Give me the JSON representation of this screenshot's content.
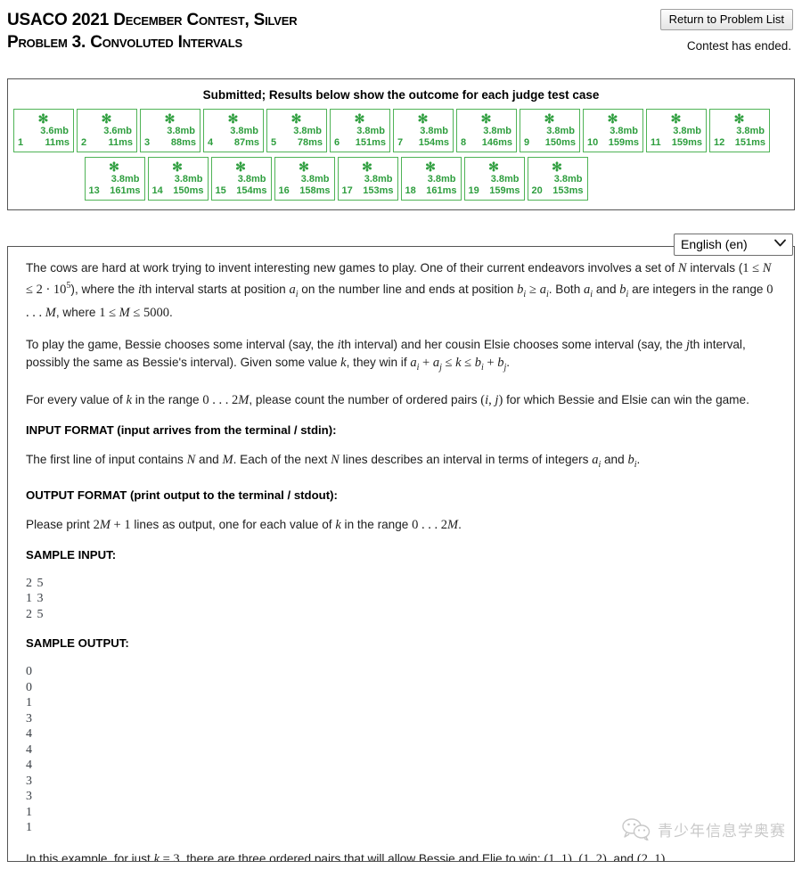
{
  "header": {
    "contest_title": "USACO 2021 December Contest, Silver",
    "problem_title": "Problem 3. Convoluted Intervals",
    "return_button": "Return to Problem List",
    "contest_status": "Contest has ended."
  },
  "results": {
    "heading": "Submitted; Results below show the outcome for each judge test case",
    "status_glyph": "✻",
    "pass_color": "#2e9e3e",
    "border_color": "#4fb356",
    "cases": [
      {
        "num": "1",
        "memory": "3.6mb",
        "time": "11ms"
      },
      {
        "num": "2",
        "memory": "3.6mb",
        "time": "11ms"
      },
      {
        "num": "3",
        "memory": "3.8mb",
        "time": "88ms"
      },
      {
        "num": "4",
        "memory": "3.8mb",
        "time": "87ms"
      },
      {
        "num": "5",
        "memory": "3.8mb",
        "time": "78ms"
      },
      {
        "num": "6",
        "memory": "3.8mb",
        "time": "151ms"
      },
      {
        "num": "7",
        "memory": "3.8mb",
        "time": "154ms"
      },
      {
        "num": "8",
        "memory": "3.8mb",
        "time": "146ms"
      },
      {
        "num": "9",
        "memory": "3.8mb",
        "time": "150ms"
      },
      {
        "num": "10",
        "memory": "3.8mb",
        "time": "159ms"
      },
      {
        "num": "11",
        "memory": "3.8mb",
        "time": "159ms"
      },
      {
        "num": "12",
        "memory": "3.8mb",
        "time": "151ms"
      },
      {
        "num": "13",
        "memory": "3.8mb",
        "time": "161ms"
      },
      {
        "num": "14",
        "memory": "3.8mb",
        "time": "150ms"
      },
      {
        "num": "15",
        "memory": "3.8mb",
        "time": "154ms"
      },
      {
        "num": "16",
        "memory": "3.8mb",
        "time": "158ms"
      },
      {
        "num": "17",
        "memory": "3.8mb",
        "time": "153ms"
      },
      {
        "num": "18",
        "memory": "3.8mb",
        "time": "161ms"
      },
      {
        "num": "19",
        "memory": "3.8mb",
        "time": "159ms"
      },
      {
        "num": "20",
        "memory": "3.8mb",
        "time": "153ms"
      }
    ]
  },
  "language": {
    "selected": "English (en)",
    "caret": "⌄"
  },
  "problem": {
    "input_format_heading": "INPUT FORMAT (input arrives from the terminal / stdin):",
    "output_format_heading": "OUTPUT FORMAT (print output to the terminal / stdout):",
    "sample_input_heading": "SAMPLE INPUT:",
    "sample_output_heading": "SAMPLE OUTPUT:",
    "sample_input": "2 5\n1 3\n2 5",
    "sample_output": "0\n0\n1\n3\n4\n4\n4\n3\n3\n1\n1"
  },
  "watermark": {
    "text": "青少年信息学奥赛"
  }
}
